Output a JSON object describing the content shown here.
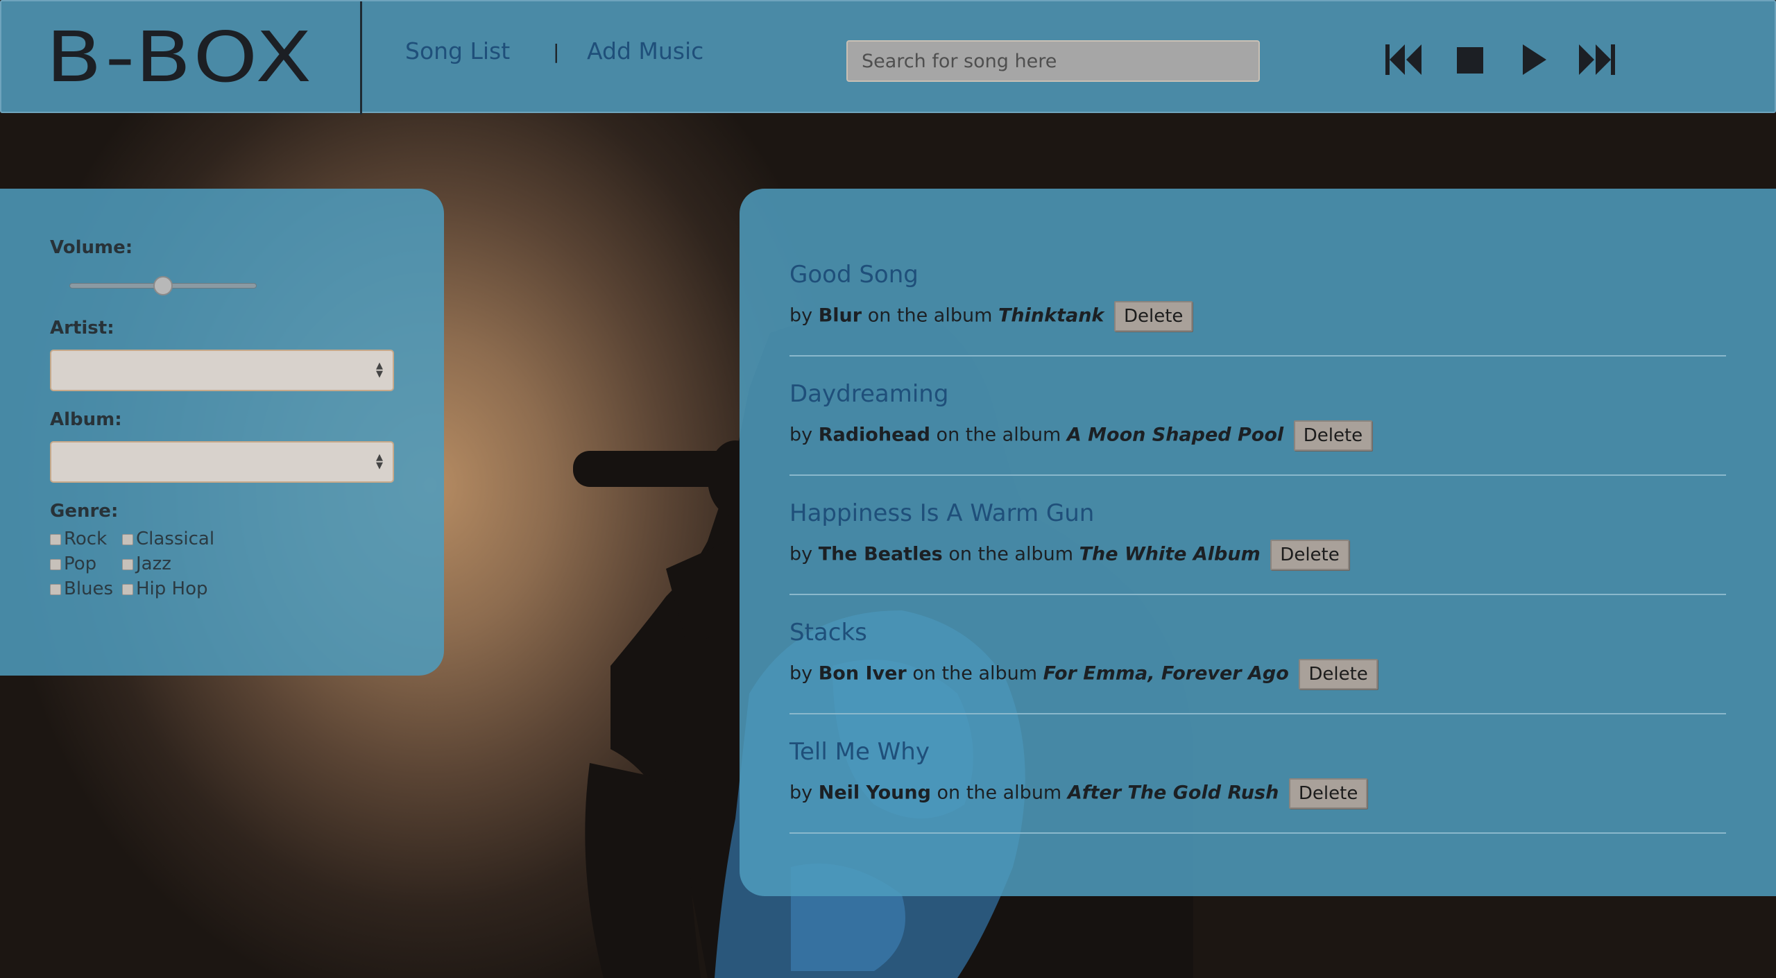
{
  "header": {
    "logo": "B-BOX",
    "nav": [
      "Song List",
      "Add Music"
    ],
    "nav_separator": "|",
    "search_placeholder": "Search for song here",
    "controls": [
      "previous-icon",
      "stop-icon",
      "play-icon",
      "next-icon"
    ]
  },
  "filters": {
    "volume_label": "Volume:",
    "volume_level": 0.5,
    "artist_label": "Artist:",
    "artist_value": "",
    "album_label": "Album:",
    "album_value": "",
    "genre_label": "Genre:",
    "genres": [
      "Rock",
      "Classical",
      "Pop",
      "Jazz",
      "Blues",
      "Hip Hop"
    ]
  },
  "songs": [
    {
      "title": "Good Song",
      "by": "by",
      "artist": "Blur",
      "on_album": "on the album",
      "album": "Thinktank",
      "delete_label": "Delete"
    },
    {
      "title": "Daydreaming",
      "by": "by",
      "artist": "Radiohead",
      "on_album": "on the album",
      "album": "A Moon Shaped Pool",
      "delete_label": "Delete"
    },
    {
      "title": "Happiness Is A Warm Gun",
      "by": "by",
      "artist": "The Beatles",
      "on_album": "on the album",
      "album": "The White Album",
      "delete_label": "Delete"
    },
    {
      "title": "Stacks",
      "by": "by",
      "artist": "Bon Iver",
      "on_album": "on the album",
      "album": "For Emma, Forever Ago",
      "delete_label": "Delete"
    },
    {
      "title": "Tell Me Why",
      "by": "by",
      "artist": "Neil Young",
      "on_album": "on the album",
      "album": "After The Gold Rush",
      "delete_label": "Delete"
    }
  ],
  "colors": {
    "panel": "#4e9cbe",
    "header": "#4a8aa6",
    "title_link": "#1f4f7a",
    "text": "#1c2024"
  }
}
